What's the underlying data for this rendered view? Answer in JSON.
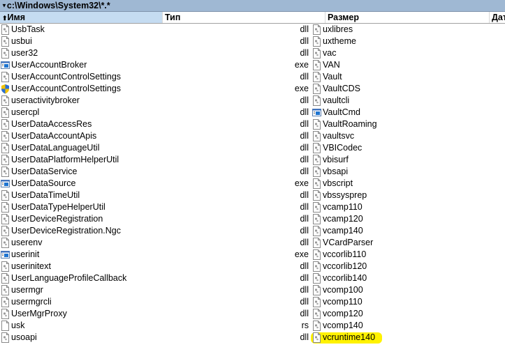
{
  "window": {
    "path": "c:\\Windows\\System32\\*.*"
  },
  "columns": {
    "name": "Имя",
    "type": "Тип",
    "size": "Размер",
    "date": "Дат"
  },
  "left": [
    {
      "name": "UsbTask",
      "ext": "dll",
      "icon": "dll"
    },
    {
      "name": "usbui",
      "ext": "dll",
      "icon": "dll"
    },
    {
      "name": "user32",
      "ext": "dll",
      "icon": "dll"
    },
    {
      "name": "UserAccountBroker",
      "ext": "exe",
      "icon": "exe"
    },
    {
      "name": "UserAccountControlSettings",
      "ext": "dll",
      "icon": "dll"
    },
    {
      "name": "UserAccountControlSettings",
      "ext": "exe",
      "icon": "shield"
    },
    {
      "name": "useractivitybroker",
      "ext": "dll",
      "icon": "dll"
    },
    {
      "name": "usercpl",
      "ext": "dll",
      "icon": "dll"
    },
    {
      "name": "UserDataAccessRes",
      "ext": "dll",
      "icon": "dll"
    },
    {
      "name": "UserDataAccountApis",
      "ext": "dll",
      "icon": "dll"
    },
    {
      "name": "UserDataLanguageUtil",
      "ext": "dll",
      "icon": "dll"
    },
    {
      "name": "UserDataPlatformHelperUtil",
      "ext": "dll",
      "icon": "dll"
    },
    {
      "name": "UserDataService",
      "ext": "dll",
      "icon": "dll"
    },
    {
      "name": "UserDataSource",
      "ext": "exe",
      "icon": "exe"
    },
    {
      "name": "UserDataTimeUtil",
      "ext": "dll",
      "icon": "dll"
    },
    {
      "name": "UserDataTypeHelperUtil",
      "ext": "dll",
      "icon": "dll"
    },
    {
      "name": "UserDeviceRegistration",
      "ext": "dll",
      "icon": "dll"
    },
    {
      "name": "UserDeviceRegistration.Ngc",
      "ext": "dll",
      "icon": "dll"
    },
    {
      "name": "userenv",
      "ext": "dll",
      "icon": "dll"
    },
    {
      "name": "userinit",
      "ext": "exe",
      "icon": "exe"
    },
    {
      "name": "userinitext",
      "ext": "dll",
      "icon": "dll"
    },
    {
      "name": "UserLanguageProfileCallback",
      "ext": "dll",
      "icon": "dll"
    },
    {
      "name": "usermgr",
      "ext": "dll",
      "icon": "dll"
    },
    {
      "name": "usermgrcli",
      "ext": "dll",
      "icon": "dll"
    },
    {
      "name": "UserMgrProxy",
      "ext": "dll",
      "icon": "dll"
    },
    {
      "name": "usk",
      "ext": "rs",
      "icon": "file"
    },
    {
      "name": "usoapi",
      "ext": "dll",
      "icon": "dll"
    }
  ],
  "right": [
    {
      "name": "uxlibres",
      "icon": "dll"
    },
    {
      "name": "uxtheme",
      "icon": "dll"
    },
    {
      "name": "vac",
      "icon": "dll"
    },
    {
      "name": "VAN",
      "icon": "dll"
    },
    {
      "name": "Vault",
      "icon": "dll"
    },
    {
      "name": "VaultCDS",
      "icon": "dll"
    },
    {
      "name": "vaultcli",
      "icon": "dll"
    },
    {
      "name": "VaultCmd",
      "icon": "exe"
    },
    {
      "name": "VaultRoaming",
      "icon": "dll"
    },
    {
      "name": "vaultsvc",
      "icon": "dll"
    },
    {
      "name": "VBICodec",
      "icon": "dll"
    },
    {
      "name": "vbisurf",
      "icon": "dll"
    },
    {
      "name": "vbsapi",
      "icon": "dll"
    },
    {
      "name": "vbscript",
      "icon": "dll"
    },
    {
      "name": "vbssysprep",
      "icon": "dll"
    },
    {
      "name": "vcamp110",
      "icon": "dll"
    },
    {
      "name": "vcamp120",
      "icon": "dll"
    },
    {
      "name": "vcamp140",
      "icon": "dll"
    },
    {
      "name": "VCardParser",
      "icon": "dll"
    },
    {
      "name": "vccorlib110",
      "icon": "dll"
    },
    {
      "name": "vccorlib120",
      "icon": "dll"
    },
    {
      "name": "vccorlib140",
      "icon": "dll"
    },
    {
      "name": "vcomp100",
      "icon": "dll"
    },
    {
      "name": "vcomp110",
      "icon": "dll"
    },
    {
      "name": "vcomp120",
      "icon": "dll"
    },
    {
      "name": "vcomp140",
      "icon": "dll"
    },
    {
      "name": "vcruntime140",
      "icon": "dll",
      "highlighted": true
    }
  ],
  "colors": {
    "highlight": "#fff200",
    "header_active": "#c5dcf1",
    "titlebar": "#9fb8d3"
  }
}
